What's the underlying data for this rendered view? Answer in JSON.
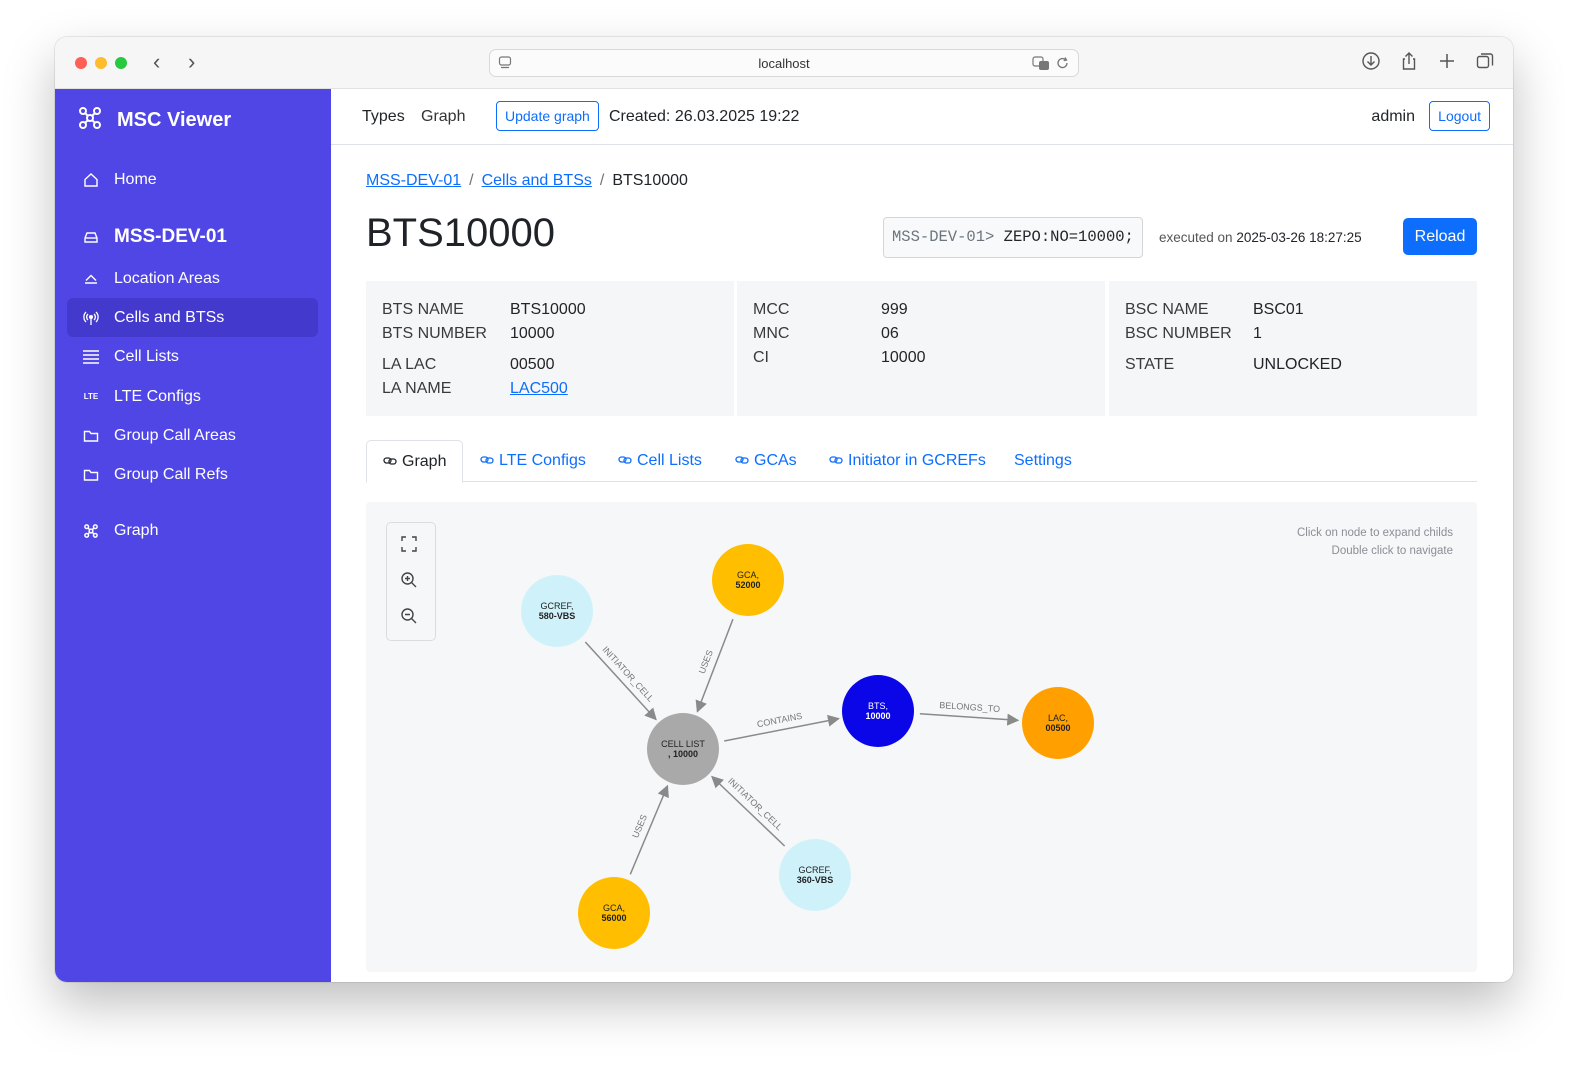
{
  "browser": {
    "url": "localhost"
  },
  "sidebar": {
    "brand": "MSC Viewer",
    "home": "Home",
    "section": "MSS-DEV-01",
    "items": [
      {
        "label": "Location Areas",
        "icon": "layers-icon"
      },
      {
        "label": "Cells and BTSs",
        "icon": "antenna-icon",
        "active": true
      },
      {
        "label": "Cell Lists",
        "icon": "list-icon"
      },
      {
        "label": "LTE Configs",
        "icon": "lte-icon",
        "icon_text": "LTE"
      },
      {
        "label": "Group Call Areas",
        "icon": "folder-icon"
      },
      {
        "label": "Group Call Refs",
        "icon": "folder-icon"
      }
    ],
    "graph": "Graph"
  },
  "topbar": {
    "types": "Types",
    "graph": "Graph",
    "update_graph": "Update graph",
    "created": "Created: 26.03.2025 19:22",
    "user": "admin",
    "logout": "Logout"
  },
  "breadcrumb": {
    "first": "MSS-DEV-01",
    "second": "Cells and BTSs",
    "current": "BTS10000",
    "separator": "/"
  },
  "title": "BTS10000",
  "command": {
    "prompt": "MSS-DEV-01>",
    "text": "ZEPO:NO=10000;"
  },
  "executed": {
    "label": "executed on",
    "timestamp": "2025-03-26 18:27:25"
  },
  "reload": "Reload",
  "info": {
    "col1": {
      "bts_name": {
        "key": "BTS NAME",
        "value": "BTS10000"
      },
      "bts_number": {
        "key": "BTS NUMBER",
        "value": "10000"
      },
      "la_lac": {
        "key": "LA LAC",
        "value": "00500"
      },
      "la_name": {
        "key": "LA NAME",
        "value": "LAC500"
      }
    },
    "col2": {
      "mcc": {
        "key": "MCC",
        "value": "999"
      },
      "mnc": {
        "key": "MNC",
        "value": "06"
      },
      "ci": {
        "key": "CI",
        "value": "10000"
      }
    },
    "col3": {
      "bsc_name": {
        "key": "BSC NAME",
        "value": "BSC01"
      },
      "bsc_number": {
        "key": "BSC NUMBER",
        "value": "1"
      },
      "state": {
        "key": "STATE",
        "value": "UNLOCKED"
      }
    }
  },
  "tabs": {
    "graph": "Graph",
    "lte": "LTE Configs",
    "cell_lists": "Cell Lists",
    "gcas": "GCAs",
    "initiator": "Initiator in GCREFs",
    "settings": "Settings"
  },
  "graph": {
    "hint1": "Click on node to expand childs",
    "hint2": "Double click to navigate",
    "colors": {
      "cell_list": "#a9a9a9",
      "bts": "#0a06e8",
      "lac": "#ffa000",
      "gca": "#ffbf00",
      "gcref": "#cff2fa",
      "edge": "#8a8a8a"
    },
    "nodes": [
      {
        "id": "cl",
        "type": "CELL LIST",
        "name": "10000"
      },
      {
        "id": "bts",
        "type": "BTS",
        "name": "10000"
      },
      {
        "id": "lac",
        "type": "LAC",
        "name": "00500"
      },
      {
        "id": "gca1",
        "type": "GCA",
        "name": "52000"
      },
      {
        "id": "gca2",
        "type": "GCA",
        "name": "56000"
      },
      {
        "id": "gcref1",
        "type": "GCREF",
        "name": "580-VBS"
      },
      {
        "id": "gcref2",
        "type": "GCREF",
        "name": "360-VBS"
      }
    ],
    "edges": [
      {
        "from": "cl",
        "to": "bts",
        "label": "CONTAINS"
      },
      {
        "from": "bts",
        "to": "lac",
        "label": "BELONGS_TO"
      },
      {
        "from": "gca1",
        "to": "cl",
        "label": "USES"
      },
      {
        "from": "gca2",
        "to": "cl",
        "label": "USES"
      },
      {
        "from": "gcref1",
        "to": "cl",
        "label": "INITIATOR_CELL"
      },
      {
        "from": "gcref2",
        "to": "cl",
        "label": "INITIATOR_CELL"
      }
    ]
  }
}
